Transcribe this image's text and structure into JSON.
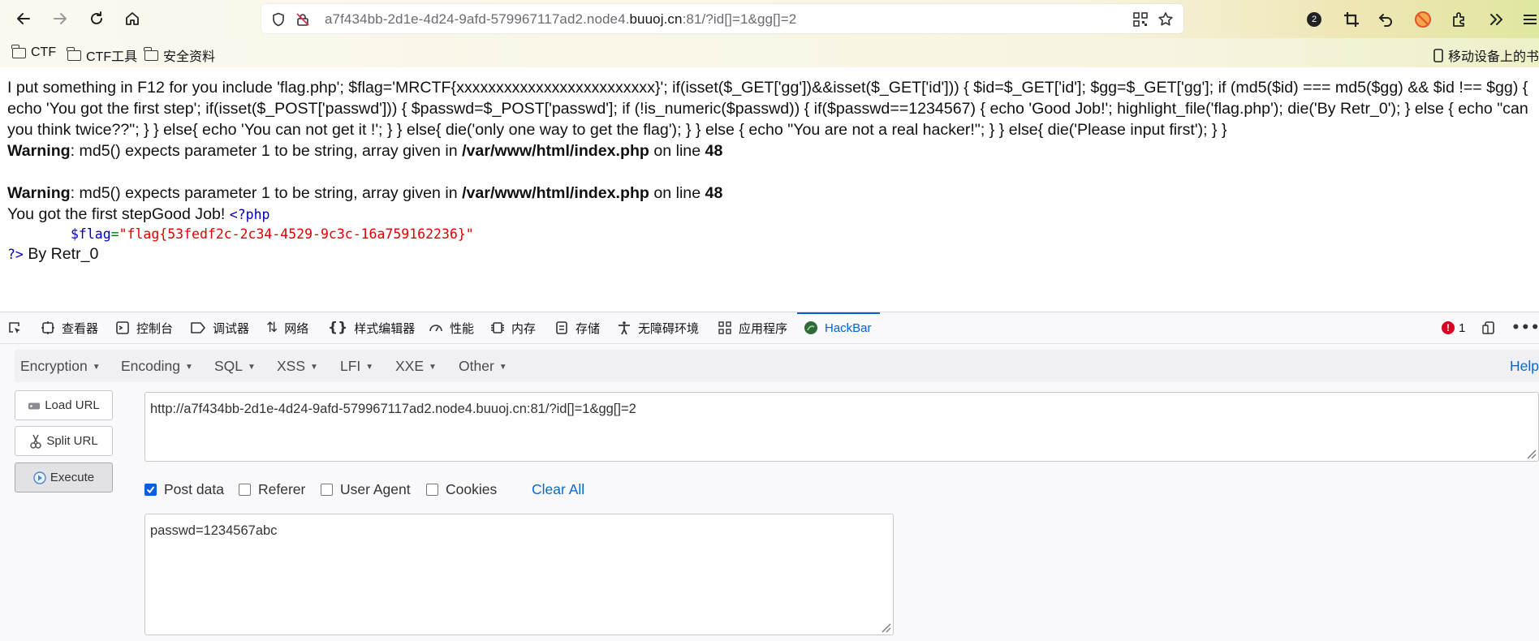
{
  "browser": {
    "url_prefix": "a7f434bb-2d1e-4d24-9afd-579967117ad2.node4.",
    "url_domain": "buuoj.cn",
    "url_suffix": ":81/?id[]=1&gg[]=2",
    "extension_badge": "2",
    "bookmarks": [
      "CTF",
      "CTF工具",
      "安全资料"
    ],
    "mobile_bookmarks": "移动设备上的书签"
  },
  "page": {
    "source_text": "I put something in F12 for you include 'flag.php'; $flag='MRCTF{xxxxxxxxxxxxxxxxxxxxxxxxx}'; if(isset($_GET['gg'])&&isset($_GET['id'])) { $id=$_GET['id']; $gg=$_GET['gg']; if (md5($id) === md5($gg) && $id !== $gg) { echo 'You got the first step'; if(isset($_POST['passwd'])) { $passwd=$_POST['passwd']; if (!is_numeric($passwd)) { if($passwd==1234567) { echo 'Good Job!'; highlight_file('flag.php'); die('By Retr_0'); } else { echo \"can you think twice??\"; } } else{ echo 'You can not get it !'; } } else{ die('only one way to get the flag'); } } else { echo \"You are not a real hacker!\"; } } else{ die('Please input first'); } }",
    "warnings": [
      {
        "label": "Warning",
        "message": ": md5() expects parameter 1 to be string, array given in ",
        "file": "/var/www/html/index.php",
        "on_line": " on line ",
        "line": "48"
      },
      {
        "label": "Warning",
        "message": ": md5() expects parameter 1 to be string, array given in ",
        "file": "/var/www/html/index.php",
        "on_line": " on line ",
        "line": "48"
      }
    ],
    "output_text": "You got the first stepGood Job! ",
    "php_open": "<?php",
    "flag_var": "$flag",
    "flag_op": "=",
    "flag_value": "\"flag{53fedf2c-2c34-4529-9c3c-16a759162236}\"",
    "php_close": "?>",
    "by_text": " By Retr_0"
  },
  "devtools": {
    "tabs": [
      "查看器",
      "控制台",
      "调试器",
      "网络",
      "样式编辑器",
      "性能",
      "内存",
      "存储",
      "无障碍环境",
      "应用程序",
      "HackBar"
    ],
    "error_count": "1"
  },
  "hackbar": {
    "menus": [
      "Encryption",
      "Encoding",
      "SQL",
      "XSS",
      "LFI",
      "XXE",
      "Other"
    ],
    "help": "Help",
    "buttons": {
      "load": "Load URL",
      "split": "Split URL",
      "execute": "Execute"
    },
    "url_value": "http://a7f434bb-2d1e-4d24-9afd-579967117ad2.node4.buuoj.cn:81/?id[]=1&gg[]=2",
    "options": [
      {
        "label": "Post data",
        "checked": true
      },
      {
        "label": "Referer",
        "checked": false
      },
      {
        "label": "User Agent",
        "checked": false
      },
      {
        "label": "Cookies",
        "checked": false
      }
    ],
    "clear_all": "Clear All",
    "post_value": "passwd=1234567abc"
  }
}
